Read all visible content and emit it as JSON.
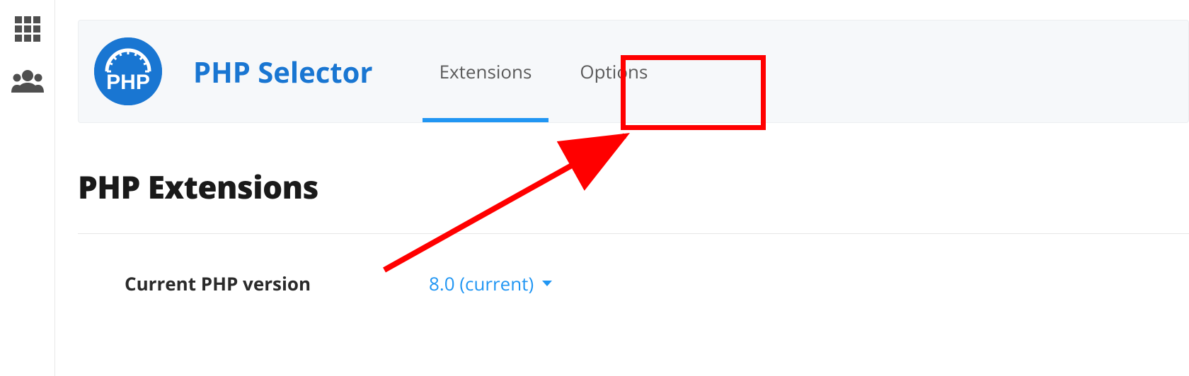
{
  "sidebar": {
    "items": [
      {
        "name": "apps-grid"
      },
      {
        "name": "users"
      }
    ]
  },
  "header": {
    "logo_text": "PHP",
    "title": "PHP Selector",
    "tabs": [
      {
        "label": "Extensions",
        "active": true
      },
      {
        "label": "Options",
        "active": false
      }
    ]
  },
  "content": {
    "section_title": "PHP Extensions",
    "current_version_label": "Current PHP version",
    "current_version_value": "8.0 (current)"
  },
  "colors": {
    "accent": "#1976d2",
    "tab_indicator": "#2196f3",
    "annotation": "#ff0000"
  }
}
